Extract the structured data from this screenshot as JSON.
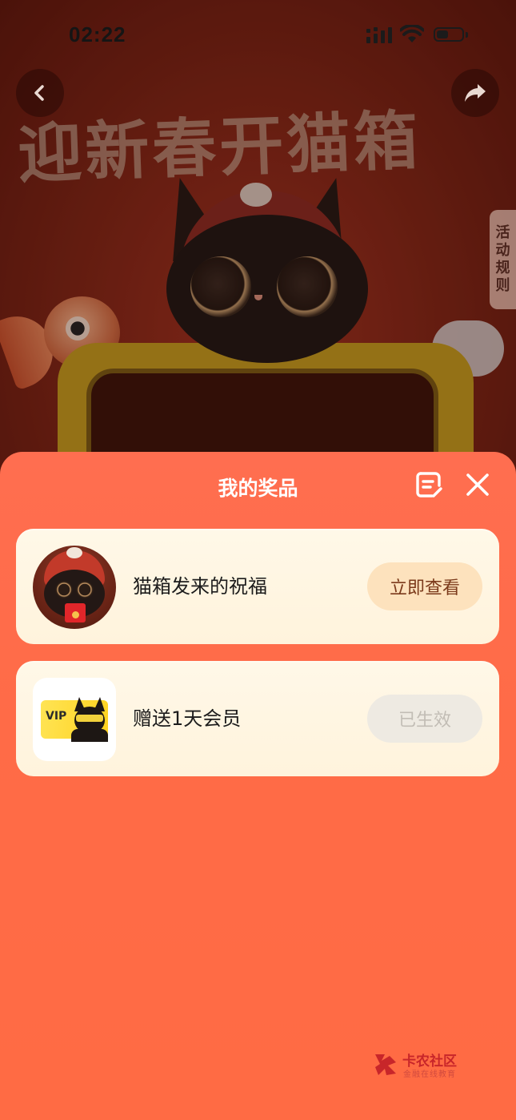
{
  "status_bar": {
    "time": "02:22",
    "battery_level": 0.45
  },
  "header": {
    "back_icon": "chevron-left-icon",
    "share_icon": "share-arrow-icon",
    "headline": "迎新春开猫箱",
    "rules_tab": [
      "活",
      "动",
      "规",
      "则"
    ]
  },
  "sheet": {
    "title": "我的奖品",
    "record_icon": "record-list-icon",
    "close_icon": "close-icon",
    "colors": {
      "background": "#ff6b47",
      "card": "#fff6e3"
    },
    "prizes": [
      {
        "name": "猫箱发来的祝福",
        "action": "立即查看",
        "state": "active",
        "thumb_icon": "cat-red-envelope-icon"
      },
      {
        "name": "赠送1天会员",
        "action": "已生效",
        "state": "disabled",
        "thumb_icon": "vip-card-icon",
        "thumb_text": "VIP"
      }
    ]
  },
  "watermark": {
    "title": "卡农社区",
    "subtitle": "金融在线教育"
  }
}
